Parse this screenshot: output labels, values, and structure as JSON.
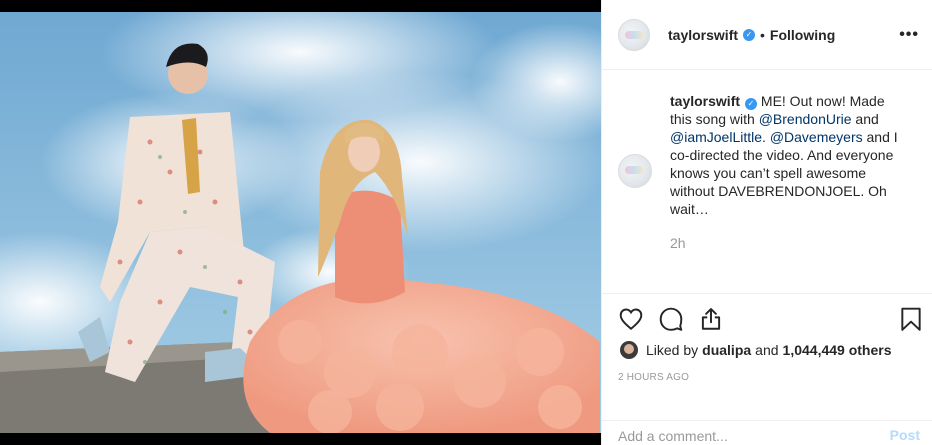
{
  "post": {
    "username": "taylorswift",
    "verified_mark": "✓",
    "separator": "•",
    "follow_status": "Following",
    "more_label": "•••",
    "caption": {
      "username": "taylorswift",
      "text_1": "ME! Out now! Made this song with ",
      "mention_1": "@BrendonUrie",
      "text_2": " and ",
      "mention_2": "@iamJoelLittle",
      "text_3": ". ",
      "mention_3": "@Davemeyers",
      "text_4": " and I co-directed the video. And everyone knows you can’t spell awesome without DAVEBRENDONJOEL. Oh wait…",
      "age": "2h"
    },
    "actions": {
      "like_icon": "heart-icon",
      "comment_icon": "speech-bubble-icon",
      "share_icon": "share-icon",
      "save_icon": "bookmark-icon"
    },
    "likes": {
      "prefix": "Liked by",
      "first_user": "dualipa",
      "joiner": "and",
      "count_text": "1,044,449 others"
    },
    "posted_ago": "2 HOURS AGO",
    "comment": {
      "placeholder": "Add a comment...",
      "value": "",
      "post_label": "Post"
    }
  },
  "colors": {
    "link": "#003569",
    "verified": "#3897f0",
    "post_disabled": "#b3dbff",
    "muted": "#999999"
  }
}
